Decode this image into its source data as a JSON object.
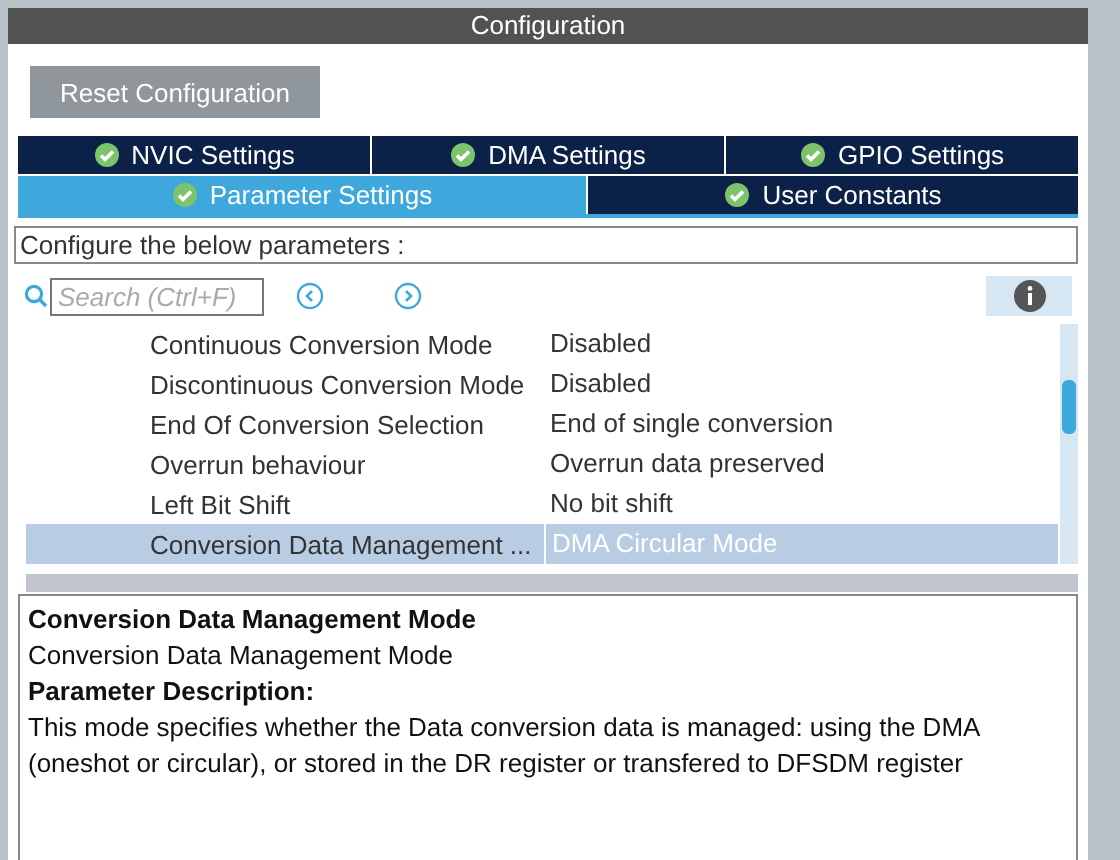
{
  "window": {
    "title": "Configuration"
  },
  "reset_button": {
    "label": "Reset Configuration"
  },
  "tab_rows": [
    {
      "tabs": [
        {
          "label": "NVIC Settings",
          "selected": false,
          "checked": true
        },
        {
          "label": "DMA Settings",
          "selected": false,
          "checked": true
        },
        {
          "label": "GPIO Settings",
          "selected": false,
          "checked": true
        }
      ]
    },
    {
      "tabs": [
        {
          "label": "Parameter Settings",
          "selected": true,
          "checked": true
        },
        {
          "label": "User Constants",
          "selected": false,
          "checked": true
        }
      ]
    }
  ],
  "hint": {
    "value": "Configure the below parameters :"
  },
  "search": {
    "placeholder": "Search (Ctrl+F)"
  },
  "parameters": [
    {
      "name": "Continuous Conversion Mode",
      "value": "Disabled",
      "selected": false
    },
    {
      "name": "Discontinuous Conversion Mode",
      "value": "Disabled",
      "selected": false
    },
    {
      "name": "End Of Conversion Selection",
      "value": "End of single conversion",
      "selected": false
    },
    {
      "name": "Overrun behaviour",
      "value": "Overrun data preserved",
      "selected": false
    },
    {
      "name": "Left Bit Shift",
      "value": "No bit shift",
      "selected": false
    },
    {
      "name": "Conversion Data Management ...",
      "value": "DMA Circular Mode",
      "selected": true
    }
  ],
  "description": {
    "title": "Conversion Data Management Mode",
    "subtitle": "Conversion Data Management Mode",
    "heading": "Parameter Description:",
    "text": "This mode specifies whether the Data conversion data is managed: using the DMA (oneshot or circular), or stored in the DR register or transfered to DFSDM register"
  }
}
